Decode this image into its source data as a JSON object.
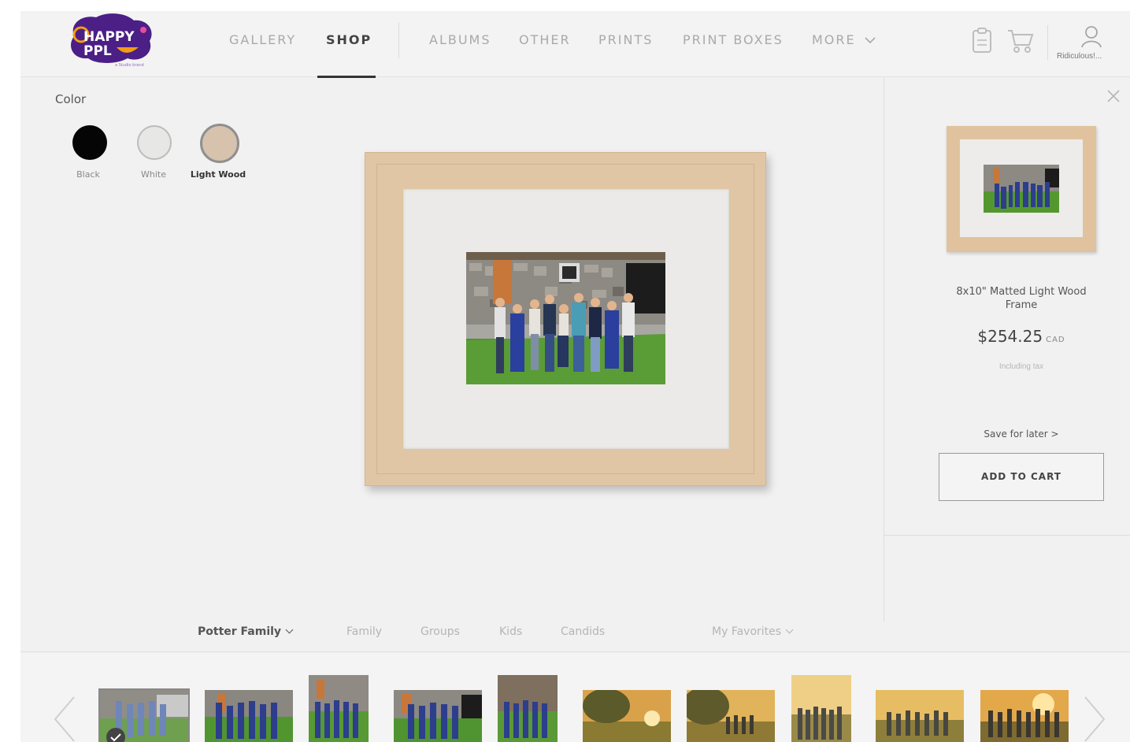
{
  "header": {
    "logo": {
      "line1": "HAPPY",
      "line2": "PPL",
      "tagline": "a Studio brand"
    },
    "nav": [
      {
        "label": "GALLERY",
        "active": false
      },
      {
        "label": "SHOP",
        "active": true
      },
      {
        "label": "ALBUMS",
        "active": false
      },
      {
        "label": "OTHER",
        "active": false
      },
      {
        "label": "PRINTS",
        "active": false
      },
      {
        "label": "PRINT BOXES",
        "active": false
      },
      {
        "label": "MORE",
        "active": false
      }
    ],
    "icons": [
      "clipboard-icon",
      "cart-icon",
      "user-icon",
      "chevron-down-icon"
    ],
    "account_name": "Ridiculous!..."
  },
  "color_panel": {
    "title": "Color",
    "swatches": [
      {
        "label": "Black",
        "color": "#050505",
        "selected": false
      },
      {
        "label": "White",
        "color": "#e7e7e5",
        "selected": false
      },
      {
        "label": "Light Wood",
        "color": "#d7c2ad",
        "selected": true
      }
    ]
  },
  "product": {
    "name": "8x10\" Matted Light Wood Frame",
    "price": "$254.25",
    "currency": "CAD",
    "tax_note": "Including tax",
    "save_for_later": "Save for later  >",
    "add_to_cart": "ADD TO CART",
    "frame_color": "#e0c6a5"
  },
  "filters": {
    "album": "Potter Family",
    "categories": [
      "Family",
      "Groups",
      "Kids",
      "Candids"
    ],
    "favorites": "My Favorites"
  },
  "filmstrip": {
    "count": 10,
    "selected_index": 0
  },
  "colors": {
    "accent_purple": "#4b1f86",
    "accent_orange": "#f39c12",
    "background": "#f1f1f1"
  }
}
